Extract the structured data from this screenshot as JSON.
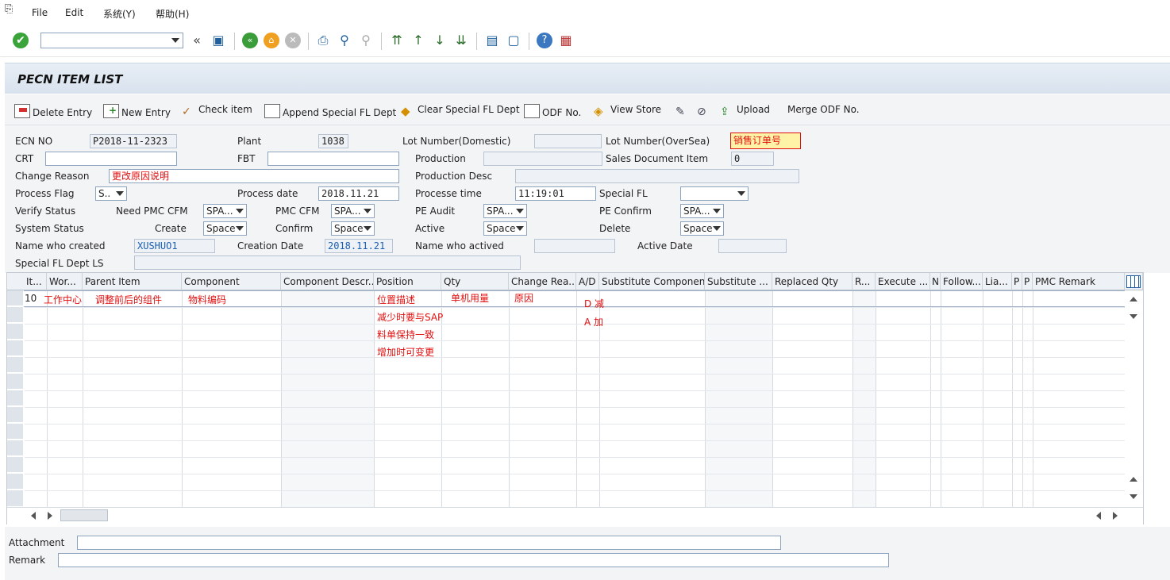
{
  "menu": {
    "file": "File",
    "edit": "Edit",
    "system": "系统(Y)",
    "help": "帮助(H)"
  },
  "toolbar": {
    "command_field": ""
  },
  "title": "PECN ITEM LIST",
  "app_toolbar": {
    "delete_entry": "Delete Entry",
    "new_entry": "New Entry",
    "check_item": "Check item",
    "append_special": "Append Special FL Dept",
    "clear_special": "Clear Special FL Dept",
    "odf_no": "ODF No.",
    "view_store": "View Store",
    "upload": "Upload",
    "merge_odf": "Merge ODF No."
  },
  "form": {
    "ecn_no": {
      "label": "ECN NO",
      "value": "P2018-11-2323"
    },
    "plant": {
      "label": "Plant",
      "value": "1038"
    },
    "lot_domestic": {
      "label": "Lot Number(Domestic)",
      "value": ""
    },
    "lot_oversea": {
      "label": "Lot Number(OverSea)",
      "value": "销售订单号"
    },
    "crt": {
      "label": "CRT",
      "value": ""
    },
    "fbt": {
      "label": "FBT",
      "value": ""
    },
    "production": {
      "label": "Production",
      "value": ""
    },
    "sales_doc_item": {
      "label": "Sales Document Item",
      "value": "0"
    },
    "change_reason": {
      "label": "Change Reason",
      "value": "更改原因说明"
    },
    "production_desc": {
      "label": "Production Desc",
      "value": ""
    },
    "process_flag": {
      "label": "Process Flag",
      "value": "S.."
    },
    "process_date": {
      "label": "Process date",
      "value": "2018.11.21"
    },
    "process_time": {
      "label": "Processe time",
      "value": "11:19:01"
    },
    "special_fl": {
      "label": "Special FL",
      "value": ""
    },
    "verify_status": {
      "label": "Verify Status"
    },
    "need_pmc_cfm": {
      "label": "Need PMC CFM",
      "value": "SPA..."
    },
    "pmc_cfm": {
      "label": "PMC CFM",
      "value": "SPA..."
    },
    "pe_audit": {
      "label": "PE Audit",
      "value": "SPA..."
    },
    "pe_confirm": {
      "label": "PE Confirm",
      "value": "SPA..."
    },
    "system_status": {
      "label": "System Status"
    },
    "create": {
      "label": "Create",
      "value": "Space"
    },
    "confirm": {
      "label": "Confirm",
      "value": "Space"
    },
    "active": {
      "label": "Active",
      "value": "Space"
    },
    "delete": {
      "label": "Delete",
      "value": "Space"
    },
    "name_created": {
      "label": "Name who created",
      "value": "XUSHUO1"
    },
    "creation_date": {
      "label": "Creation Date",
      "value": "2018.11.21"
    },
    "name_actived": {
      "label": "Name who actived",
      "value": ""
    },
    "active_date": {
      "label": "Active  Date",
      "value": ""
    },
    "special_fl_dept_ls": {
      "label": "Special FL Dept LS",
      "value": ""
    }
  },
  "table": {
    "columns": [
      "It...",
      "Wor...",
      "Parent Item",
      "Component",
      "Component Descr...",
      "Position",
      "Qty",
      "Change Rea...",
      "A/D",
      "Substitute Component",
      "Substitute ...",
      "Replaced Qty",
      "R...",
      "Execute ...",
      "N",
      "Follow...",
      "Lia...",
      "P",
      "P",
      "PMC Remark"
    ],
    "row1": {
      "item": "10",
      "work": "工作中心",
      "parent": "调整前后的组件",
      "component": "物料编码",
      "position": "位置描述",
      "qty": "单机用量",
      "change_reason": "原因",
      "ad": "D  减"
    },
    "row2": {
      "position": "减少时要与SAP",
      "ad": "A  加"
    },
    "row3": {
      "position": "料单保持一致"
    },
    "row4": {
      "position": "增加时可变更"
    }
  },
  "bottom": {
    "attachment": {
      "label": "Attachment",
      "value": ""
    },
    "remark": {
      "label": "Remark",
      "value": ""
    }
  },
  "colors": {
    "accent_red": "#e01010",
    "header_bg": "#eef1f5",
    "title_bg": "#d8e2ee"
  }
}
